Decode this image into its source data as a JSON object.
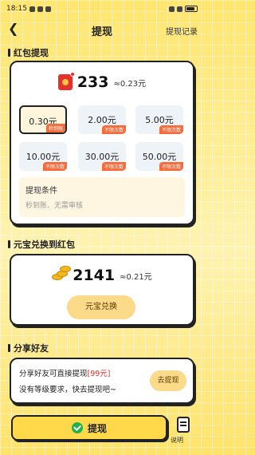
{
  "status": {
    "time": "18:15"
  },
  "header": {
    "title": "提现",
    "records": "提现记录"
  },
  "redpacket": {
    "section": "红包提现",
    "balance": "233",
    "approx": "≈0.23元",
    "options": [
      {
        "amount": "0.30元",
        "tag": "秒到账",
        "selected": true
      },
      {
        "amount": "2.00元",
        "tag": "不限次数"
      },
      {
        "amount": "5.00元",
        "tag": "不限次数"
      },
      {
        "amount": "10.00元",
        "tag": "不限次数"
      },
      {
        "amount": "30.00元",
        "tag": "不限次数"
      },
      {
        "amount": "50.00元",
        "tag": "不限次数"
      }
    ],
    "condition_title": "提现条件",
    "condition_desc": "秒到账、无需审核"
  },
  "ingot": {
    "section": "元宝兑换到红包",
    "balance": "2141",
    "approx": "≈0.21元",
    "button": "元宝兑换"
  },
  "share": {
    "section": "分享好友",
    "line1_prefix": "分享好友可直接提现",
    "line1_highlight": "[99元]",
    "line2": "没有等级要求，快去提现吧~",
    "button": "去提现"
  },
  "footer": {
    "button": "提现",
    "side_label": "说明"
  },
  "colors": {
    "accent": "#FFD94A",
    "tag": "#F56B3B",
    "highlight": "#E8302A"
  }
}
